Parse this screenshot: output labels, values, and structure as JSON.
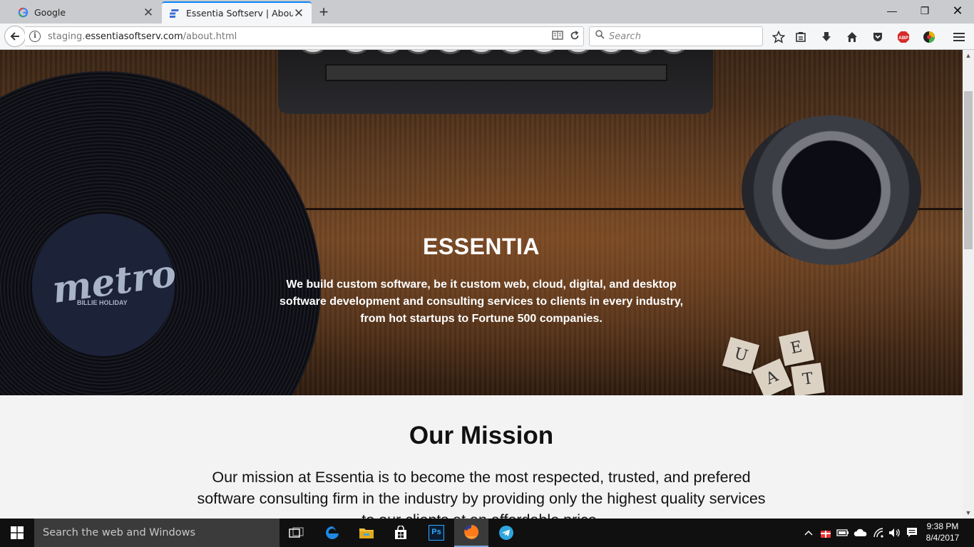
{
  "browser": {
    "tabs": [
      {
        "title": "Google",
        "favicon": "google-g-icon",
        "active": false
      },
      {
        "title": "Essentia Softserv | About",
        "favicon": "essentia-logo-icon",
        "active": true
      }
    ],
    "url": {
      "prefix": "staging.",
      "host": "essentiasoftserv.com",
      "path": "/about.html"
    },
    "search_placeholder": "Search",
    "toolbar_icons": [
      "bookmark-star-icon",
      "reading-list-icon",
      "downloads-icon",
      "home-icon",
      "pocket-icon",
      "adblock-icon",
      "extension-icon",
      "menu-icon"
    ]
  },
  "hero": {
    "title": "ESSENTIA",
    "tagline": "We build custom software, be it custom web, cloud, digital, and desktop software development and consulting services to clients in every industry, from hot startups to Fortune 500 companies.",
    "record_label": {
      "brand": "metro",
      "artist": "BILLIE HOLIDAY"
    },
    "tiles": [
      "U",
      "A",
      "E",
      "T"
    ]
  },
  "mission": {
    "title": "Our Mission",
    "text": "Our mission at Essentia is to become the most respected, trusted, and prefered software consulting firm in the industry by providing only the highest quality services to our clients at an affordable price."
  },
  "taskbar": {
    "search_placeholder": "Search the web and Windows",
    "apps": [
      "task-view-icon",
      "edge-icon",
      "file-explorer-icon",
      "store-icon",
      "photoshop-icon",
      "firefox-icon",
      "telegram-icon"
    ],
    "photoshop_label": "Ps",
    "time": "9:38 PM",
    "date": "8/4/2017"
  },
  "colors": {
    "accent": "#0a84ff",
    "taskbar": "#101010",
    "page_bg": "#f3f3f3"
  }
}
